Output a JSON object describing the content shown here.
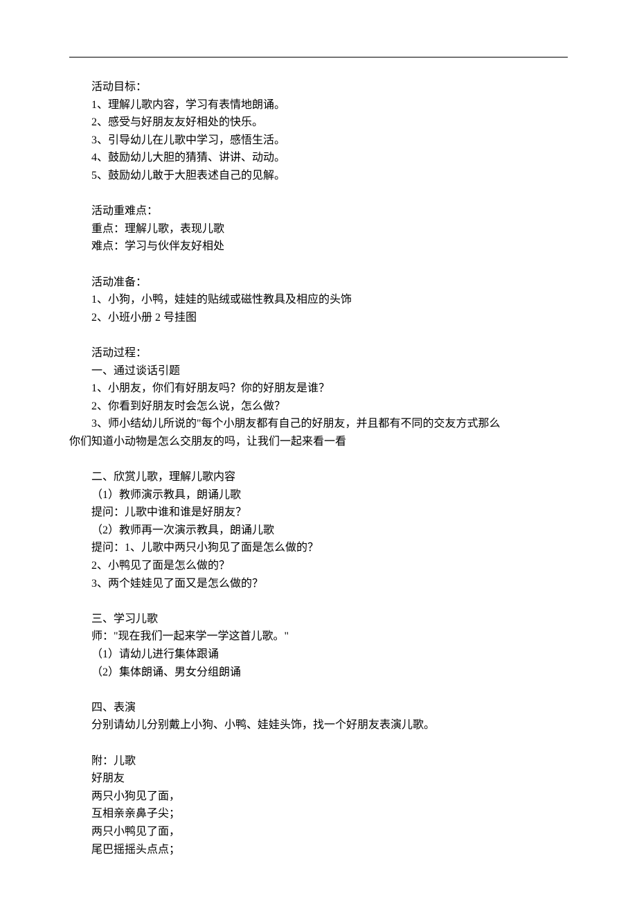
{
  "sections": {
    "goals": {
      "title": "活动目标：",
      "items": [
        "1、理解儿歌内容，学习有表情地朗诵。",
        "2、感受与好朋友友好相处的快乐。",
        "3、引导幼儿在儿歌中学习，感悟生活。",
        "4、鼓励幼儿大胆的猜猜、讲讲、动动。",
        "5、鼓励幼儿敢于大胆表述自己的见解。"
      ]
    },
    "difficulty": {
      "title": "活动重难点：",
      "items": [
        "重点：理解儿歌，表现儿歌",
        "难点：学习与伙伴友好相处"
      ]
    },
    "preparation": {
      "title": "活动准备：",
      "items": [
        "1、小狗，小鸭，娃娃的贴绒或磁性教具及相应的头饰",
        "2、小班小册 2 号挂图"
      ]
    },
    "process": {
      "title": "活动过程：",
      "part1": {
        "title": "一、通过谈话引题",
        "items": [
          "1、小朋友，你们有好朋友吗？你的好朋友是谁？",
          "2、你看到好朋友时会怎么说，怎么做？"
        ],
        "summary_line1": "3、师小结幼儿所说的\"每个小朋友都有自己的好朋友，并且都有不同的交友方式那么",
        "summary_line2": "你们知道小动物是怎么交朋友的吗，让我们一起来看一看"
      },
      "part2": {
        "title": "二、欣赏儿歌，理解儿歌内容",
        "items": [
          "（1）教师演示教具，朗诵儿歌",
          "提问：儿歌中谁和谁是好朋友？",
          "（2）教师再一次演示教具，朗诵儿歌",
          "提问：1、儿歌中两只小狗见了面是怎么做的？",
          "2、小鸭见了面是怎么做的？",
          "3、两个娃娃见了面又是怎么做的？"
        ]
      },
      "part3": {
        "title": "三、学习儿歌",
        "intro": "师：\"现在我们一起来学一学这首儿歌。\"",
        "items": [
          "（1）请幼儿进行集体跟诵",
          "（2）集体朗诵、男女分组朗诵"
        ]
      },
      "part4": {
        "title": "四、表演",
        "items": [
          "分别请幼儿分别戴上小狗、小鸭、娃娃头饰，找一个好朋友表演儿歌。"
        ]
      }
    },
    "appendix": {
      "title": "附：儿歌",
      "name": "好朋友",
      "lines": [
        "两只小狗见了面，",
        "互相亲亲鼻子尖；",
        "两只小鸭见了面，",
        "尾巴摇摇头点点；"
      ]
    }
  }
}
